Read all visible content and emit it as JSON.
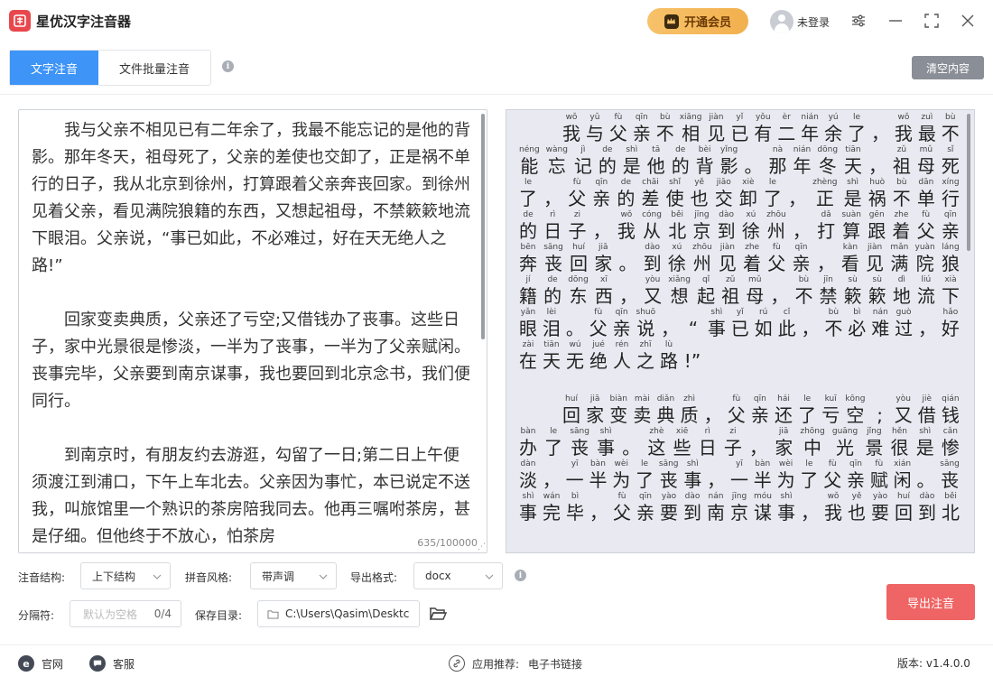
{
  "app": {
    "title": "星优汉字注音器",
    "vip_label": "开通会员",
    "login_label": "未登录"
  },
  "tabs": [
    {
      "label": "文字注音",
      "active": true
    },
    {
      "label": "文件批量注音",
      "active": false
    }
  ],
  "clear_label": "清空内容",
  "editor": {
    "paragraphs": [
      "我与父亲不相见已有二年余了，我最不能忘记的是他的背影。那年冬天，祖母死了，父亲的差使也交卸了，正是祸不单行的日子，我从北京到徐州，打算跟着父亲奔丧回家。到徐州见着父亲，看见满院狼籍的东西，又想起祖母，不禁簌簌地流下眼泪。父亲说，“事已如此，不必难过，好在天无绝人之路!”",
      "回家变卖典质，父亲还了亏空;又借钱办了丧事。这些日子，家中光景很是惨淡，一半为了丧事，一半为了父亲赋闲。丧事完毕，父亲要到南京谋事，我也要回到北京念书，我们便同行。",
      "到南京时，有朋友约去游逛，勾留了一日;第二日上午便须渡江到浦口，下午上车北去。父亲因为事忙，本已说定不送我，叫旅馆里一个熟识的茶房陪我同去。他再三嘱咐茶房，甚是仔细。但他终于不放心，怕茶房"
    ],
    "char_count": "635/100000"
  },
  "preview": {
    "lines": [
      {
        "style": "indent",
        "chars": [
          [
            "wǒ",
            "我"
          ],
          [
            "yǔ",
            "与"
          ],
          [
            "fù",
            "父"
          ],
          [
            "qīn",
            "亲"
          ],
          [
            "bù",
            "不"
          ],
          [
            "xiāng",
            "相"
          ],
          [
            "jiàn",
            "见"
          ],
          [
            "yǐ",
            "已"
          ],
          [
            "yǒu",
            "有"
          ],
          [
            "èr",
            "二"
          ],
          [
            "nián",
            "年"
          ],
          [
            "yú",
            "余"
          ],
          [
            "le",
            "了"
          ],
          [
            "",
            "，"
          ],
          [
            "wǒ",
            "我"
          ],
          [
            "zuì",
            "最"
          ],
          [
            "bù",
            "不"
          ]
        ]
      },
      {
        "style": "",
        "chars": [
          [
            "néng",
            "能"
          ],
          [
            "wàng",
            "忘"
          ],
          [
            "jì",
            "记"
          ],
          [
            "de",
            "的"
          ],
          [
            "shì",
            "是"
          ],
          [
            "tā",
            "他"
          ],
          [
            "de",
            "的"
          ],
          [
            "bèi",
            "背"
          ],
          [
            "yǐng",
            "影"
          ],
          [
            "",
            "。"
          ],
          [
            "nà",
            "那"
          ],
          [
            "nián",
            "年"
          ],
          [
            "dōng",
            "冬"
          ],
          [
            "tiān",
            "天"
          ],
          [
            "",
            "，"
          ],
          [
            "zǔ",
            "祖"
          ],
          [
            "mǔ",
            "母"
          ],
          [
            "sǐ",
            "死"
          ]
        ]
      },
      {
        "style": "",
        "chars": [
          [
            "le",
            "了"
          ],
          [
            "",
            "，"
          ],
          [
            "fù",
            "父"
          ],
          [
            "qīn",
            "亲"
          ],
          [
            "de",
            "的"
          ],
          [
            "chāi",
            "差"
          ],
          [
            "shǐ",
            "使"
          ],
          [
            "yě",
            "也"
          ],
          [
            "jiāo",
            "交"
          ],
          [
            "xiè",
            "卸"
          ],
          [
            "le",
            "了"
          ],
          [
            "",
            "，"
          ],
          [
            "zhèng",
            "正"
          ],
          [
            "shì",
            "是"
          ],
          [
            "huò",
            "祸"
          ],
          [
            "bù",
            "不"
          ],
          [
            "dān",
            "单"
          ],
          [
            "xíng",
            "行"
          ]
        ]
      },
      {
        "style": "",
        "chars": [
          [
            "de",
            "的"
          ],
          [
            "rì",
            "日"
          ],
          [
            "zi",
            "子"
          ],
          [
            "",
            "，"
          ],
          [
            "wǒ",
            "我"
          ],
          [
            "cóng",
            "从"
          ],
          [
            "běi",
            "北"
          ],
          [
            "jīng",
            "京"
          ],
          [
            "dào",
            "到"
          ],
          [
            "xú",
            "徐"
          ],
          [
            "zhōu",
            "州"
          ],
          [
            "",
            "，"
          ],
          [
            "dǎ",
            "打"
          ],
          [
            "suàn",
            "算"
          ],
          [
            "gēn",
            "跟"
          ],
          [
            "zhe",
            "着"
          ],
          [
            "fù",
            "父"
          ],
          [
            "qīn",
            "亲"
          ]
        ]
      },
      {
        "style": "",
        "chars": [
          [
            "bēn",
            "奔"
          ],
          [
            "sāng",
            "丧"
          ],
          [
            "huí",
            "回"
          ],
          [
            "jiā",
            "家"
          ],
          [
            "",
            "。"
          ],
          [
            "dào",
            "到"
          ],
          [
            "xú",
            "徐"
          ],
          [
            "zhōu",
            "州"
          ],
          [
            "jiàn",
            "见"
          ],
          [
            "zhe",
            "着"
          ],
          [
            "fù",
            "父"
          ],
          [
            "qīn",
            "亲"
          ],
          [
            "",
            "，"
          ],
          [
            "kàn",
            "看"
          ],
          [
            "jiàn",
            "见"
          ],
          [
            "mǎn",
            "满"
          ],
          [
            "yuàn",
            "院"
          ],
          [
            "láng",
            "狼"
          ]
        ]
      },
      {
        "style": "",
        "chars": [
          [
            "jí",
            "籍"
          ],
          [
            "de",
            "的"
          ],
          [
            "dōng",
            "东"
          ],
          [
            "xī",
            "西"
          ],
          [
            "",
            "，"
          ],
          [
            "yòu",
            "又"
          ],
          [
            "xiǎng",
            "想"
          ],
          [
            "qǐ",
            "起"
          ],
          [
            "zǔ",
            "祖"
          ],
          [
            "mǔ",
            "母"
          ],
          [
            "",
            "，"
          ],
          [
            "bù",
            "不"
          ],
          [
            "jīn",
            "禁"
          ],
          [
            "sù",
            "簌"
          ],
          [
            "sù",
            "簌"
          ],
          [
            "dì",
            "地"
          ],
          [
            "liú",
            "流"
          ],
          [
            "xià",
            "下"
          ]
        ]
      },
      {
        "style": "",
        "chars": [
          [
            "yǎn",
            "眼"
          ],
          [
            "lèi",
            "泪"
          ],
          [
            "",
            "。"
          ],
          [
            "fù",
            "父"
          ],
          [
            "qīn",
            "亲"
          ],
          [
            "shuō",
            "说"
          ],
          [
            "",
            "，"
          ],
          [
            "",
            "“"
          ],
          [
            "shì",
            "事"
          ],
          [
            "yǐ",
            "已"
          ],
          [
            "rú",
            "如"
          ],
          [
            "cǐ",
            "此"
          ],
          [
            "",
            "，"
          ],
          [
            "bù",
            "不"
          ],
          [
            "bì",
            "必"
          ],
          [
            "nán",
            "难"
          ],
          [
            "guò",
            "过"
          ],
          [
            "",
            "，"
          ],
          [
            "hǎo",
            "好"
          ]
        ]
      },
      {
        "style": "short",
        "chars": [
          [
            "zài",
            "在"
          ],
          [
            "tiān",
            "天"
          ],
          [
            "wú",
            "无"
          ],
          [
            "jué",
            "绝"
          ],
          [
            "rén",
            "人"
          ],
          [
            "zhī",
            "之"
          ],
          [
            "lù",
            "路"
          ],
          [
            "",
            "!”"
          ]
        ]
      },
      {
        "style": "indent gap",
        "chars": [
          [
            "huí",
            "回"
          ],
          [
            "jiā",
            "家"
          ],
          [
            "biàn",
            "变"
          ],
          [
            "mài",
            "卖"
          ],
          [
            "diǎn",
            "典"
          ],
          [
            "zhì",
            "质"
          ],
          [
            "",
            "，"
          ],
          [
            "fù",
            "父"
          ],
          [
            "qīn",
            "亲"
          ],
          [
            "hái",
            "还"
          ],
          [
            "le",
            "了"
          ],
          [
            "kuī",
            "亏"
          ],
          [
            "kōng",
            "空"
          ],
          [
            "",
            ";"
          ],
          [
            "yòu",
            "又"
          ],
          [
            "jiè",
            "借"
          ],
          [
            "qián",
            "钱"
          ]
        ]
      },
      {
        "style": "",
        "chars": [
          [
            "bàn",
            "办"
          ],
          [
            "le",
            "了"
          ],
          [
            "sāng",
            "丧"
          ],
          [
            "shì",
            "事"
          ],
          [
            "",
            "。"
          ],
          [
            "zhè",
            "这"
          ],
          [
            "xiē",
            "些"
          ],
          [
            "rì",
            "日"
          ],
          [
            "zi",
            "子"
          ],
          [
            "",
            "，"
          ],
          [
            "jiā",
            "家"
          ],
          [
            "zhōng",
            "中"
          ],
          [
            "guāng",
            "光"
          ],
          [
            "jǐng",
            "景"
          ],
          [
            "hěn",
            "很"
          ],
          [
            "shì",
            "是"
          ],
          [
            "cǎn",
            "惨"
          ]
        ]
      },
      {
        "style": "",
        "chars": [
          [
            "dàn",
            "淡"
          ],
          [
            "",
            "，"
          ],
          [
            "yī",
            "一"
          ],
          [
            "bàn",
            "半"
          ],
          [
            "wèi",
            "为"
          ],
          [
            "le",
            "了"
          ],
          [
            "sāng",
            "丧"
          ],
          [
            "shì",
            "事"
          ],
          [
            "",
            "，"
          ],
          [
            "yī",
            "一"
          ],
          [
            "bàn",
            "半"
          ],
          [
            "wèi",
            "为"
          ],
          [
            "le",
            "了"
          ],
          [
            "fù",
            "父"
          ],
          [
            "qīn",
            "亲"
          ],
          [
            "fù",
            "赋"
          ],
          [
            "xián",
            "闲"
          ],
          [
            "",
            "。"
          ],
          [
            "sāng",
            "丧"
          ]
        ]
      },
      {
        "style": "",
        "chars": [
          [
            "shì",
            "事"
          ],
          [
            "wán",
            "完"
          ],
          [
            "bì",
            "毕"
          ],
          [
            "",
            "，"
          ],
          [
            "fù",
            "父"
          ],
          [
            "qīn",
            "亲"
          ],
          [
            "yào",
            "要"
          ],
          [
            "dào",
            "到"
          ],
          [
            "nán",
            "南"
          ],
          [
            "jīng",
            "京"
          ],
          [
            "móu",
            "谋"
          ],
          [
            "shì",
            "事"
          ],
          [
            "",
            "，"
          ],
          [
            "wǒ",
            "我"
          ],
          [
            "yě",
            "也"
          ],
          [
            "yào",
            "要"
          ],
          [
            "huí",
            "回"
          ],
          [
            "dào",
            "到"
          ],
          [
            "běi",
            "北"
          ]
        ]
      }
    ]
  },
  "settings": {
    "structure_label": "注音结构:",
    "structure_value": "上下结构",
    "style_label": "拼音风格:",
    "style_value": "带声调",
    "format_label": "导出格式:",
    "format_value": "docx",
    "separator_label": "分隔符:",
    "separator_placeholder": "默认为空格",
    "separator_count": "0/4",
    "save_label": "保存目录:",
    "save_path": "C:\\Users\\Qasim\\Desktc",
    "export_label": "导出注音"
  },
  "footer": {
    "website": "官网",
    "service": "客服",
    "recommend_label": "应用推荐:",
    "recommend_link": "电子书链接",
    "version": "版本: v1.4.0.0"
  },
  "colors": {
    "accent": "#3e94f7",
    "export": "#ef6464",
    "vip": "#f2b04e"
  }
}
